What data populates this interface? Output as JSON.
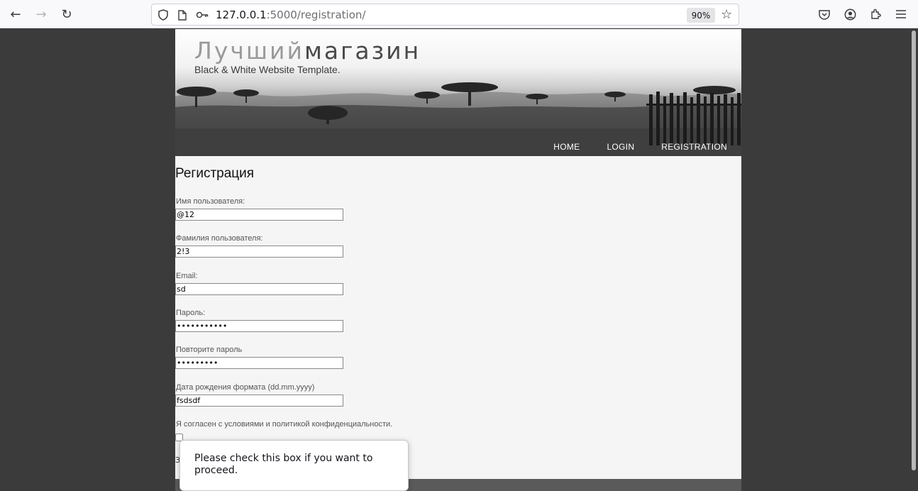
{
  "browser": {
    "url_host": "127.0.0.1",
    "url_path": ":5000/registration/",
    "zoom": "90%"
  },
  "site": {
    "logo_part1": "Лучший",
    "logo_part2": "магазин",
    "tagline": "Black & White Website Template.",
    "menu": [
      "HOME",
      "LOGIN",
      "REGISTRATION"
    ]
  },
  "form": {
    "title": "Регистрация",
    "fields": [
      {
        "label": "Имя пользователя:",
        "value": "@12",
        "type": "text"
      },
      {
        "label": "Фамилия пользователя:",
        "value": "2!3",
        "type": "text"
      },
      {
        "label": "Email:",
        "value": "sd",
        "type": "text"
      },
      {
        "label": "Пароль:",
        "value": "•••••••••••",
        "type": "password"
      },
      {
        "label": "Повторите пароль",
        "value": "•••••••••",
        "type": "password"
      },
      {
        "label": "Дата рождения формата (dd.mm.yyyy)",
        "value": "fsdsdf",
        "type": "text"
      }
    ],
    "agree_label": "Я согласен с условиями и политикой конфиденциальности.",
    "agree_checked": false,
    "below_checkbox_glyph": "З"
  },
  "tooltip": {
    "text": "Please check this box if you want to proceed."
  }
}
